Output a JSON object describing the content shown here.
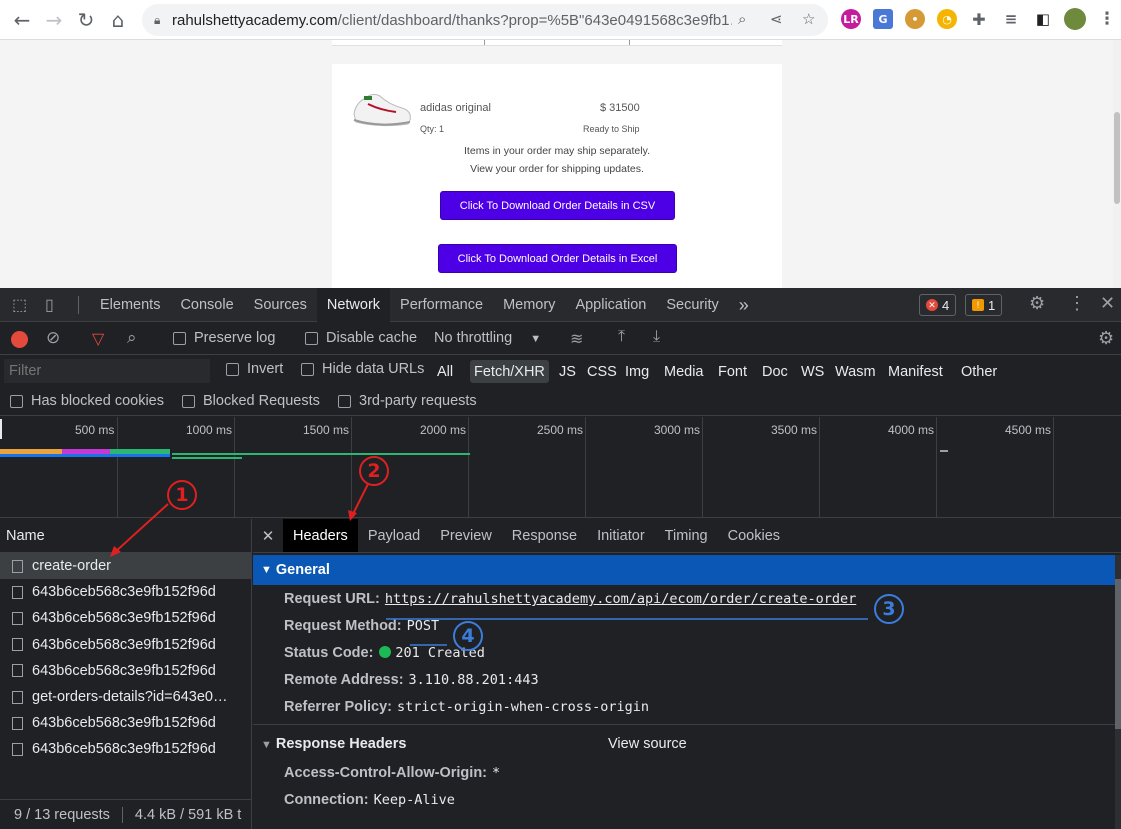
{
  "browser": {
    "url_host": "rahulshettyacademy.com",
    "url_path": "/client/dashboard/thanks?prop=%5B\"643e0491568c3e9fb1…"
  },
  "page": {
    "product": {
      "name": "adidas original",
      "price": "$ 31500",
      "qty": "Qty: 1",
      "status": "Ready to Ship"
    },
    "note1": "Items in your order may ship separately.",
    "note2": "View your order for shipping updates.",
    "csv_button": "Click To Download Order Details in CSV",
    "excel_button": "Click To Download Order Details in Excel"
  },
  "devtools": {
    "tabs": [
      "Elements",
      "Console",
      "Sources",
      "Network",
      "Performance",
      "Memory",
      "Application",
      "Security"
    ],
    "more": "»",
    "errors": "4",
    "warnings": "1",
    "toolbar": {
      "preserve_log": "Preserve log",
      "disable_cache": "Disable cache",
      "throttling": "No throttling"
    },
    "filter": {
      "placeholder": "Filter",
      "invert": "Invert",
      "hide_data_urls": "Hide data URLs",
      "types": [
        "All",
        "Fetch/XHR",
        "JS",
        "CSS",
        "Img",
        "Media",
        "Font",
        "Doc",
        "WS",
        "Wasm",
        "Manifest",
        "Other"
      ],
      "selected_type": "Fetch/XHR",
      "has_blocked_cookies": "Has blocked cookies",
      "blocked_requests": "Blocked Requests",
      "third_party": "3rd-party requests"
    },
    "timeline_ticks": [
      "500 ms",
      "1000 ms",
      "1500 ms",
      "2000 ms",
      "2500 ms",
      "3000 ms",
      "3500 ms",
      "4000 ms",
      "4500 ms"
    ],
    "name_header": "Name",
    "requests": [
      "create-order",
      "643b6ceb568c3e9fb152f96d",
      "643b6ceb568c3e9fb152f96d",
      "643b6ceb568c3e9fb152f96d",
      "643b6ceb568c3e9fb152f96d",
      "get-orders-details?id=643e0…",
      "643b6ceb568c3e9fb152f96d",
      "643b6ceb568c3e9fb152f96d"
    ],
    "status_bar": "9 / 13 requests",
    "transfer": "4.4 kB / 591 kB t",
    "detail_tabs": [
      "Headers",
      "Payload",
      "Preview",
      "Response",
      "Initiator",
      "Timing",
      "Cookies"
    ],
    "general": {
      "title": "General",
      "request_url_label": "Request URL:",
      "request_url": "https://rahulshettyacademy.com/api/ecom/order/create-order",
      "method_label": "Request Method:",
      "method": "POST",
      "status_label": "Status Code:",
      "status": "201 Created",
      "remote_label": "Remote Address:",
      "remote": "3.110.88.201:443",
      "referrer_label": "Referrer Policy:",
      "referrer": "strict-origin-when-cross-origin"
    },
    "response_headers": {
      "title": "Response Headers",
      "view_source": "View source",
      "acao_label": "Access-Control-Allow-Origin:",
      "acao": "*",
      "connection_label": "Connection:",
      "connection": "Keep-Alive"
    }
  },
  "annotations": [
    "1",
    "2",
    "3",
    "4"
  ],
  "colors": {
    "button_purple": "#4d00e6",
    "selected_section": "#0b57b5",
    "status_green": "#1db954",
    "annotation_red": "#e02020",
    "annotation_blue": "#3b7ddd"
  }
}
